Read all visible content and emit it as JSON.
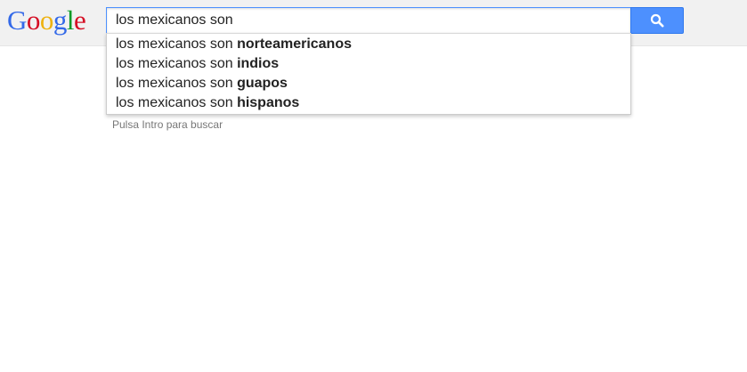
{
  "logo": {
    "letters": [
      "G",
      "o",
      "o",
      "g",
      "l",
      "e"
    ],
    "colors": [
      "#3369e8",
      "#d50f25",
      "#eeb211",
      "#3369e8",
      "#009925",
      "#d50f25"
    ]
  },
  "search": {
    "query": "los mexicanos son",
    "button_icon": "search-icon",
    "button_color": "#4d90fe"
  },
  "suggestions": [
    {
      "prefix": "los mexicanos son ",
      "completion": "norteamericanos"
    },
    {
      "prefix": "los mexicanos son ",
      "completion": "indios"
    },
    {
      "prefix": "los mexicanos son ",
      "completion": "guapos"
    },
    {
      "prefix": "los mexicanos son ",
      "completion": "hispanos"
    }
  ],
  "hint": "Pulsa Intro para buscar"
}
